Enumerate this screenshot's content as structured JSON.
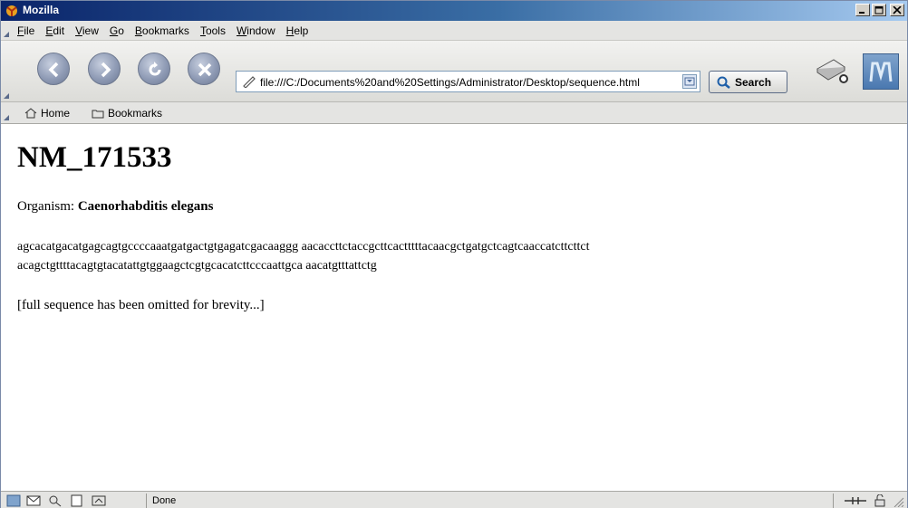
{
  "window": {
    "title": "Mozilla"
  },
  "menu": [
    "File",
    "Edit",
    "View",
    "Go",
    "Bookmarks",
    "Tools",
    "Window",
    "Help"
  ],
  "navbar": {
    "url": "file:///C:/Documents%20and%20Settings/Administrator/Desktop/sequence.html",
    "search_label": "Search"
  },
  "personal_toolbar": {
    "home_label": "Home",
    "bookmarks_label": "Bookmarks"
  },
  "page": {
    "title": "NM_171533",
    "organism_label": "Organism:",
    "organism_value": "Caenorhabditis elegans",
    "sequence_line1": "agcacatgacatgagcagtgccccaaatgatgactgtgagatcgacaaggg aacaccttctaccgcttcactttttacaacgctgatgctcagtcaaccatcttcttct",
    "sequence_line2": "acagctgttttacagtgtacatattgtggaagctcgtgcacatcttcccaattgca aacatgtttattctg",
    "omitted_note": "[full sequence has been omitted for brevity...]"
  },
  "status": {
    "text": "Done"
  },
  "colors": {
    "titlebar": "#0a246a",
    "nav_button": "#8f9bb5"
  }
}
